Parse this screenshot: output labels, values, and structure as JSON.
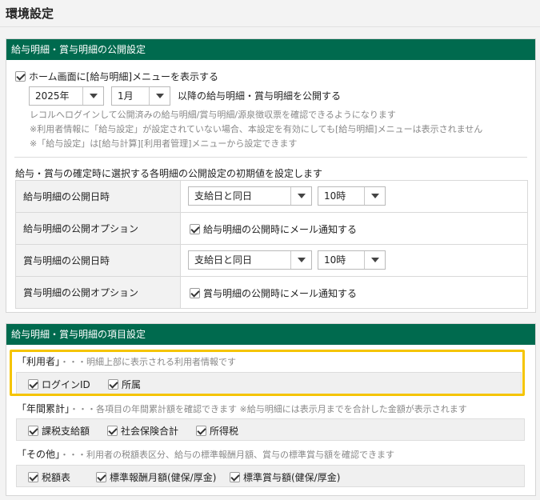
{
  "page": {
    "title": "環境設定"
  },
  "publish": {
    "header": "給与明細・賞与明細の公開設定",
    "show_menu": {
      "checked": true,
      "label": "ホーム画面に[給与明細]メニューを表示する"
    },
    "year": "2025年",
    "month": "1月",
    "after_text": "以降の給与明細・賞与明細を公開する",
    "notes": [
      "レコルへログインして公開済みの給与明細/賞与明細/源泉徴収票を確認できるようになります",
      "※利用者情報に「給与設定」が設定されていない場合、本設定を有効にしても[給与明細]メニューは表示されません",
      "※「給与設定」は[給与計算][利用者管理]メニューから設定できます"
    ],
    "default_heading": "給与・賞与の確定時に選択する各明細の公開設定の初期値を設定します",
    "rows": [
      {
        "label": "給与明細の公開日時",
        "date": "支給日と同日",
        "time": "10時"
      },
      {
        "label": "給与明細の公開オプション",
        "option": "給与明細の公開時にメール通知する"
      },
      {
        "label": "賞与明細の公開日時",
        "date": "支給日と同日",
        "time": "10時"
      },
      {
        "label": "賞与明細の公開オプション",
        "option": "賞与明細の公開時にメール通知する"
      }
    ]
  },
  "items": {
    "header": "給与明細・賞与明細の項目設定",
    "user": {
      "label": "「利用者」",
      "desc": "・・・明細上部に表示される利用者情報です",
      "options": [
        "ログインID",
        "所属"
      ]
    },
    "annual": {
      "label": "「年間累計」",
      "desc": "・・・各項目の年間累計額を確認できます ※給与明細には表示月までを合計した金額が表示されます",
      "options": [
        "課税支給額",
        "社会保険合計",
        "所得税"
      ]
    },
    "other": {
      "label": "「その他」",
      "desc": "・・・利用者の税額表区分、給与の標準報酬月額、賞与の標準賞与額を確認できます",
      "options": [
        "税額表",
        "標準報酬月額(健保/厚金)",
        "標準賞与額(健保/厚金)"
      ]
    }
  },
  "colors": {
    "header_green": "#006a4e",
    "highlight": "#f5c400"
  }
}
